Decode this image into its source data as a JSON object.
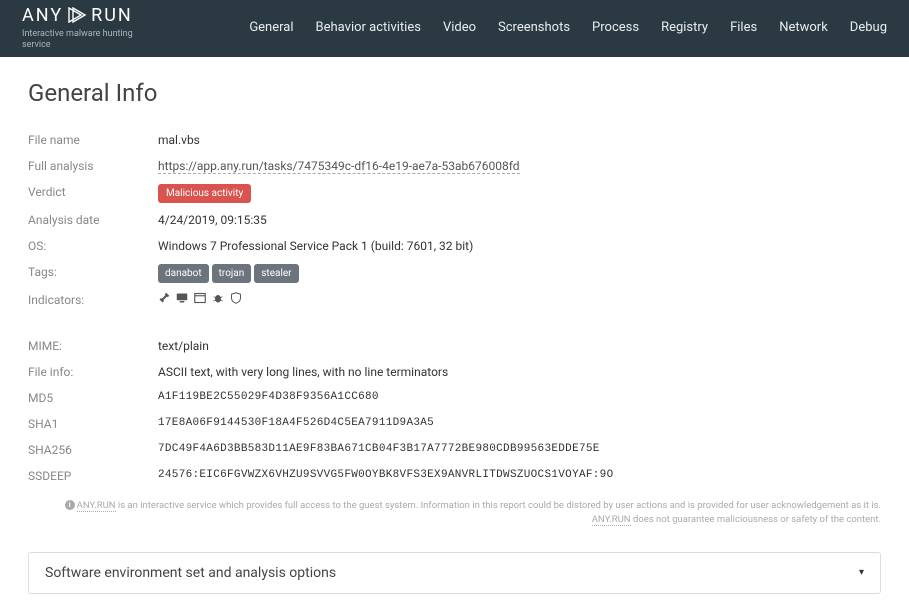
{
  "brand": {
    "name": "ANY",
    "name2": "RUN",
    "sub": "Interactive malware hunting service"
  },
  "nav": [
    "General",
    "Behavior activities",
    "Video",
    "Screenshots",
    "Process",
    "Registry",
    "Files",
    "Network",
    "Debug"
  ],
  "title": "General Info",
  "info": {
    "filename_label": "File name",
    "filename": "mal.vbs",
    "analysis_label": "Full analysis",
    "analysis": "https://app.any.run/tasks/7475349c-df16-4e19-ae7a-53ab676008fd",
    "verdict_label": "Verdict",
    "verdict": "Malicious activity",
    "date_label": "Analysis date",
    "date": "4/24/2019, 09:15:35",
    "os_label": "OS:",
    "os": "Windows 7 Professional Service Pack 1 (build: 7601, 32 bit)",
    "tags_label": "Tags:",
    "tags": [
      "danabot",
      "trojan",
      "stealer"
    ],
    "indicators_label": "Indicators:",
    "mime_label": "MIME:",
    "mime": "text/plain",
    "fileinfo_label": "File info:",
    "fileinfo": "ASCII text, with very long lines, with no line terminators",
    "md5_label": "MD5",
    "md5": "A1F119BE2C55029F4D38F9356A1CC680",
    "sha1_label": "SHA1",
    "sha1": "17E8A06F9144530F18A4F526D4C5EA7911D9A3A5",
    "sha256_label": "SHA256",
    "sha256": "7DC49F4A6D3BB583D11AE9F83BA671CB04F3B17A7772BE980CDB99563EDDE75E",
    "ssdeep_label": "SSDEEP",
    "ssdeep": "24576:EIC6FGVWZX6VHZU9SVVG5FW0OYBK8VFS3EX9ANVRLITDWSZUOCS1VOYAF:9O"
  },
  "disclaimer": {
    "brand": "ANY.RUN",
    "p1": " is an interactive service which provides full access to the guest system. Information in this report could be distored by user actions and is provided for user acknowledgement as it is. ",
    "p2": " does not guarantee maliciousness or safety of the content."
  },
  "accordion": {
    "title": "Software environment set and analysis options"
  }
}
